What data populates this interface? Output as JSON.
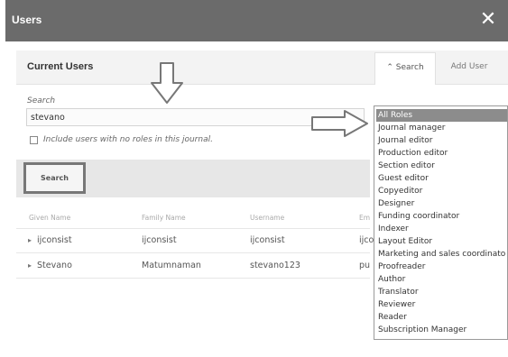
{
  "modal": {
    "title": "Users"
  },
  "panel": {
    "heading": "Current Users",
    "tabs": [
      {
        "label": "⌃ Search"
      },
      {
        "label": "Add User"
      }
    ]
  },
  "search": {
    "label": "Search",
    "value": "stevano",
    "include_label": "Include users with no roles in this journal.",
    "button_label": "Search"
  },
  "table": {
    "headers": [
      "Given Name",
      "Family Name",
      "Username",
      "Em"
    ],
    "rows": [
      {
        "given": "ijconsist",
        "family": "ijconsist",
        "username": "ijconsist",
        "email": "ijco"
      },
      {
        "given": "Stevano",
        "family": "Matumnaman",
        "username": "stevano123",
        "email": "pu"
      }
    ]
  },
  "roles_dropdown": {
    "selected": "All Roles",
    "options": [
      "All Roles",
      "Journal manager",
      "Journal editor",
      "Production editor",
      "Section editor",
      "Guest editor",
      "Copyeditor",
      "Designer",
      "Funding coordinator",
      "Indexer",
      "Layout Editor",
      "Marketing and sales coordinato",
      "Proofreader",
      "Author",
      "Translator",
      "Reviewer",
      "Reader",
      "Subscription Manager"
    ]
  }
}
